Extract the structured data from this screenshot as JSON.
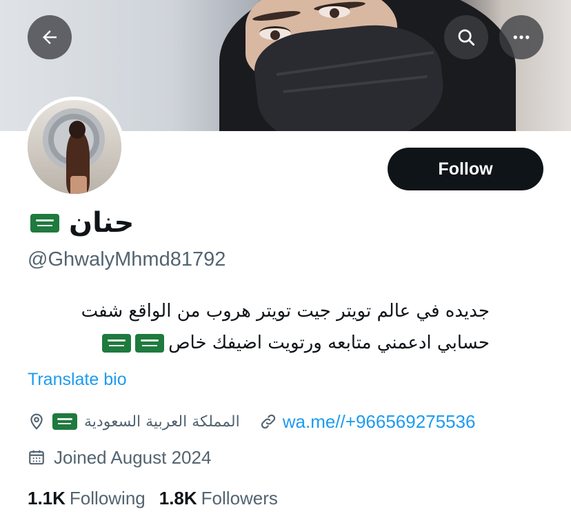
{
  "header": {
    "back_icon": "arrow-left-icon",
    "search_icon": "search-icon",
    "more_icon": "more-horizontal-icon"
  },
  "profile": {
    "display_name": "حنان",
    "name_flag": "saudi-flag",
    "handle": "@GhwalyMhmd81792",
    "follow_label": "Follow",
    "bio_line1": "جديده في عالم تويتر جيت تويتر هروب من الواقع شفت",
    "bio_line2": "حسابي ادعمني متابعه ورتويت اضيفك خاص",
    "translate_label": "Translate bio",
    "location": "المملكة العربية السعودية",
    "link": "wa.me//+966569275536",
    "joined": "Joined August 2024",
    "following_count": "1.1K",
    "following_label": "Following",
    "followers_count": "1.8K",
    "followers_label": "Followers"
  },
  "colors": {
    "accent": "#1d9bf0",
    "text_primary": "#0f1419",
    "text_secondary": "#536471",
    "follow_button_bg": "#0f1419",
    "flag_green": "#1f7a3e"
  }
}
